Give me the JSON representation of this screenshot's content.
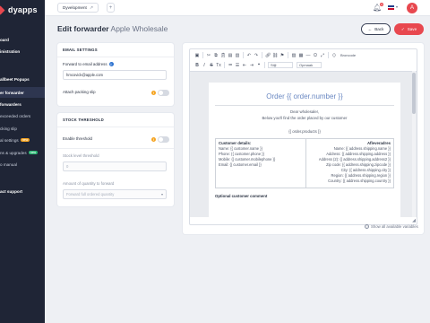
{
  "brand": {
    "logo_text": "dyapps",
    "accent": "#e8484f",
    "sidebar_bg": "#1f2536"
  },
  "sidebar": {
    "items": [
      {
        "label": "oard",
        "style": "bold"
      },
      {
        "label": "inistration",
        "style": "bold"
      },
      {
        "label": "allbeet Popups",
        "style": "bold"
      },
      {
        "label": "er forwarder",
        "style": "active"
      },
      {
        "label": "forwarders",
        "style": "bold"
      },
      {
        "label": "exceeded orders",
        "style": "normal"
      },
      {
        "label": "cking slip",
        "style": "normal"
      },
      {
        "label": "al settings",
        "style": "normal",
        "badge": "new",
        "badge_color": "orange"
      },
      {
        "label": "ns & upgrades",
        "style": "normal",
        "badge": "new",
        "badge_color": "green"
      },
      {
        "label": "o manual",
        "style": "normal"
      },
      {
        "label": "act support",
        "style": "bold"
      }
    ]
  },
  "topbar": {
    "store_name": "Dyvelopment",
    "store_link_icon": "external-link-icon",
    "add_label": "+",
    "notification_count": "0",
    "language_flag": "uk-flag",
    "avatar_initial": "A"
  },
  "header": {
    "title_strong": "Edit forwarder",
    "title_sub": "Apple Wholesale",
    "back_label": "Back",
    "back_icon": "arrow-left-icon",
    "save_label": "Save",
    "save_icon": "check-icon"
  },
  "email_settings": {
    "title": "EMAIL SETTINGS",
    "forward_label": "Forward to email address",
    "forward_value": "hmcovick@apple.com",
    "attach_label": "Attach packing slip",
    "attach_enabled": false
  },
  "stock_threshold": {
    "title": "STOCK THRESHOLD",
    "enable_label": "Enable threshold",
    "enable_enabled": false,
    "stock_level_label": "Stock level threshold",
    "stock_level_value": "0",
    "amount_label": "Amount of quantity to forward",
    "amount_selected": "Forward full ordered quantity"
  },
  "editor": {
    "toolbar": {
      "source_label": "Broncode",
      "format_label": "Stijl",
      "size_label": "Opmaak"
    },
    "document": {
      "title": "Order {{ order.number }}",
      "greeting": "Dear wholesaler,",
      "intro": "Below you'll find the order placed by our customer",
      "products": "{{ order.products }}",
      "customer_title": "Customer details:",
      "customer_lines": [
        "Name: {{ customer.name }}",
        "Phone: {{ customer.phone }}",
        "Mobile: {{ customer.mobilephone }}",
        "Email: {{ customer.email }}"
      ],
      "shipping_title": "Afleveradres",
      "shipping_lines": [
        "Name: {{ address.shipping.name }}",
        "Address: {{ address.shipping.address }}",
        "Address (2): {{ address.shipping.address2 }}",
        "Zip code: {{ address.shipping.zipcode }}",
        "City: {{ address.shipping.city }}",
        "Region: {{ address.shipping.region }}",
        "Country: {{ address.shipping.country }}"
      ],
      "comment_title": "Optional customer comment"
    }
  },
  "footer_link": "Show all available variables"
}
